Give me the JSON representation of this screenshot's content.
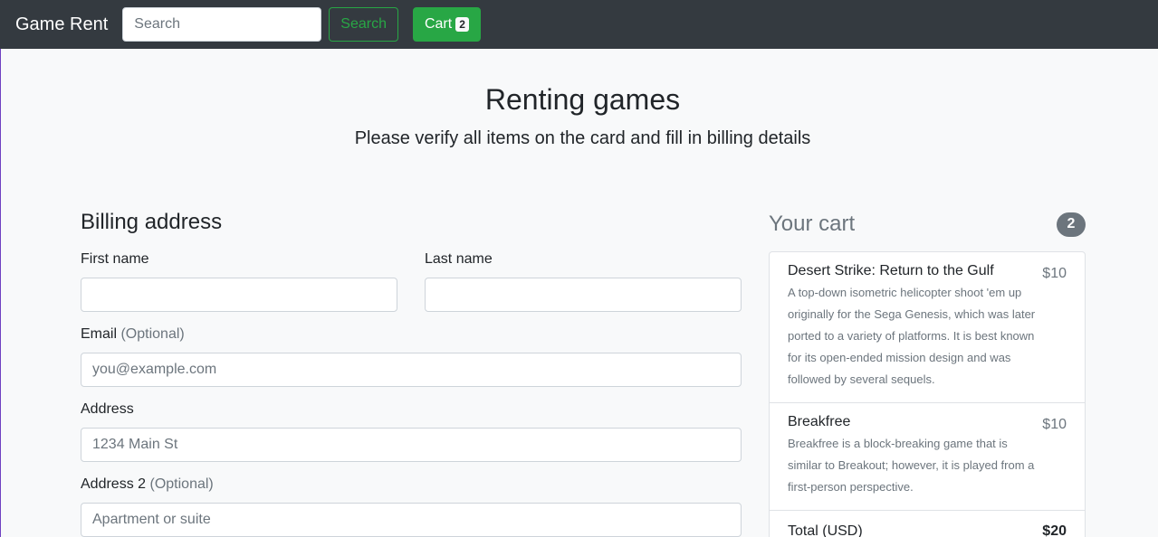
{
  "navbar": {
    "brand": "Game Rent",
    "search_placeholder": "Search",
    "search_button": "Search",
    "cart_label": "Cart",
    "cart_count": "2"
  },
  "header": {
    "title": "Renting games",
    "lead": "Please verify all items on the card and fill in billing details"
  },
  "billing": {
    "heading": "Billing address",
    "first_name_label": "First name",
    "last_name_label": "Last name",
    "email_label": "Email",
    "email_optional": "(Optional)",
    "email_placeholder": "you@example.com",
    "address_label": "Address",
    "address_placeholder": "1234 Main St",
    "address2_label": "Address 2",
    "address2_optional": "(Optional)",
    "address2_placeholder": "Apartment or suite"
  },
  "cart": {
    "heading": "Your cart",
    "count": "2",
    "items": [
      {
        "name": "Desert Strike: Return to the Gulf",
        "price": "$10",
        "description": "A top-down isometric helicopter shoot 'em up originally for the Sega Genesis, which was later ported to a variety of platforms. It is best known for its open-ended mission design and was followed by several sequels."
      },
      {
        "name": "Breakfree",
        "price": "$10",
        "description": "Breakfree is a block-breaking game that is similar to Breakout; however, it is played from a first-person perspective."
      }
    ],
    "total_label": "Total (USD)",
    "total_value": "$20"
  },
  "colors": {
    "navbar_bg": "#343a40",
    "success": "#28a745",
    "muted": "#6c757d",
    "page_bg": "#f8f9fa"
  }
}
